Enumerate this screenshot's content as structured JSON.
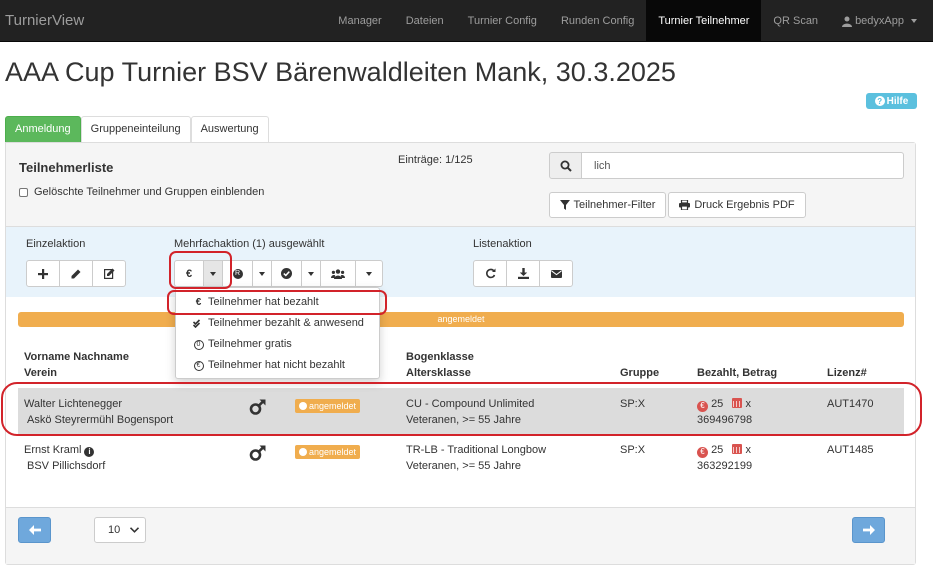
{
  "navbar": {
    "brand": "TurnierView",
    "items": [
      "Manager",
      "Dateien",
      "Turnier Config",
      "Runden Config",
      "Turnier Teilnehmer",
      "QR Scan"
    ],
    "active_index": 4,
    "user": "bedyxApp"
  },
  "page": {
    "title": "AAA Cup Turnier BSV Bärenwaldleiten Mank, 30.3.2025",
    "help_label": "Hilfe"
  },
  "tabs": [
    "Anmeldung",
    "Gruppeneinteilung",
    "Auswertung"
  ],
  "panel": {
    "title": "Teilnehmerliste",
    "show_deleted_label": "Gelöschte Teilnehmer und Gruppen einblenden",
    "entries_text": "Einträge: 1/125",
    "search_value": "lich",
    "filter_button": "Teilnehmer-Filter",
    "print_button": "Druck Ergebnis PDF"
  },
  "actions": {
    "single_label": "Einzelaktion",
    "multi_label": "Mehrfachaktion (1) ausgewählt",
    "list_label": "Listenaktion"
  },
  "menu": {
    "items": [
      "Teilnehmer hat bezahlt",
      "Teilnehmer bezahlt & anwesend",
      "Teilnehmer gratis",
      "Teilnehmer hat nicht bezahlt"
    ]
  },
  "status_bar": "angemeldet",
  "table": {
    "headers": {
      "name": "Vorname Nachname",
      "club": "Verein",
      "bow": "Bogenklasse",
      "age": "Altersklasse",
      "group": "Gruppe",
      "paid": "Bezahlt, Betrag",
      "license": "Lizenz#"
    },
    "rows": [
      {
        "name": "Walter Lichtenegger",
        "club": "Askö Steyrermühl Bogensport",
        "status": "angemeldet",
        "bow": "CU - Compound Unlimited",
        "age": "Veteranen, >= 55 Jahre",
        "group": "SP:X",
        "amount": "25",
        "mark": "x",
        "number": "369496798",
        "license": "AUT1470",
        "selected": true
      },
      {
        "name": "Ernst Kraml",
        "club": "BSV Pillichsdorf",
        "status": "angemeldet",
        "bow": "TR-LB - Traditional Longbow",
        "age": "Veteranen, >= 55 Jahre",
        "group": "SP:X",
        "amount": "25",
        "mark": "x",
        "number": "363292199",
        "license": "AUT1485",
        "selected": false
      }
    ]
  },
  "footer": {
    "page_size": "10"
  },
  "colors": {
    "success": "#5cb85c",
    "warning": "#f0ad4e",
    "info": "#5bc0de",
    "danger": "#d9534f",
    "annotation": "#d2232a"
  }
}
